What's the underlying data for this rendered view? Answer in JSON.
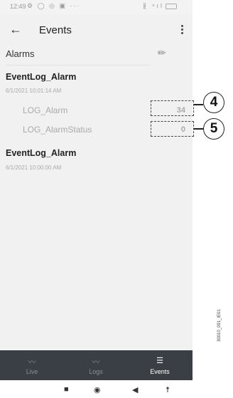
{
  "status_bar": {
    "time": "12:49",
    "left_icons": "⚙ ◯ ◎ ▣ ···",
    "right_icons": "∦ ⁿıl"
  },
  "app_bar": {
    "back_icon": "arrow-left",
    "title": "Events",
    "menu_icon": "more-vert"
  },
  "alarms_section": {
    "label": "Alarms",
    "edit_icon": "pencil"
  },
  "events": [
    {
      "name": "EventLog_Alarm",
      "timestamp": "6/1/2021 10:01:14 AM",
      "logs": [
        {
          "label": "LOG_Alarm",
          "value": "34"
        },
        {
          "label": "LOG_AlarmStatus",
          "value": "0"
        }
      ]
    },
    {
      "name": "EventLog_Alarm",
      "timestamp": "6/1/2021 10:00:00 AM"
    }
  ],
  "callouts": [
    "4",
    "5"
  ],
  "bottom_nav": [
    {
      "label": "Live",
      "icon": "trend-line",
      "active": false
    },
    {
      "label": "Logs",
      "icon": "trend-line",
      "active": false
    },
    {
      "label": "Events",
      "icon": "list",
      "active": true
    }
  ],
  "system_nav": {
    "square": "■",
    "circle": "◉",
    "back": "◀",
    "accessibility": "☨"
  },
  "side_code": "30010_091_IE01"
}
